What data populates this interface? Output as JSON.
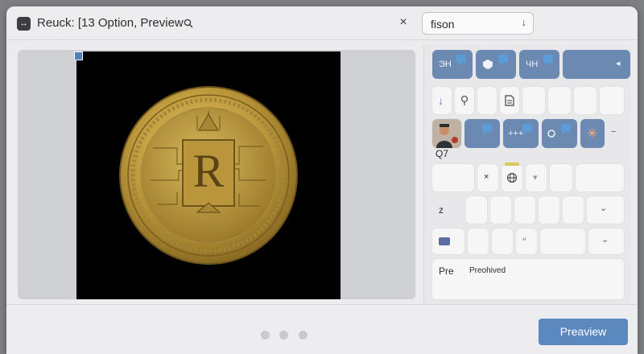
{
  "header": {
    "title": "Reuck: [13 Option, Preview",
    "close_symbol": "×",
    "select_value": "fison",
    "select_arrow": "↓"
  },
  "grid": {
    "row1": {
      "c1": "ЭН",
      "c3": "ЧН"
    },
    "row2": {
      "c1": "↓"
    },
    "row3": {
      "c3": "+++"
    },
    "labels": {
      "r3": "Q7",
      "r5": "z",
      "r7_left": "Pre",
      "r7_right": "Preohived"
    },
    "cell_symbols": {
      "x": "×",
      "quote": "“",
      "chev_down": "⌄",
      "more": "−",
      "asterisk": "✳",
      "arrow": "◂"
    }
  },
  "footer": {
    "preview_label": "Preaview"
  },
  "colors": {
    "accent": "#5b88bf",
    "tile_blue": "#6b89b1",
    "flag_blue": "#5a9bd8",
    "coin_gold": "#c9a845"
  }
}
